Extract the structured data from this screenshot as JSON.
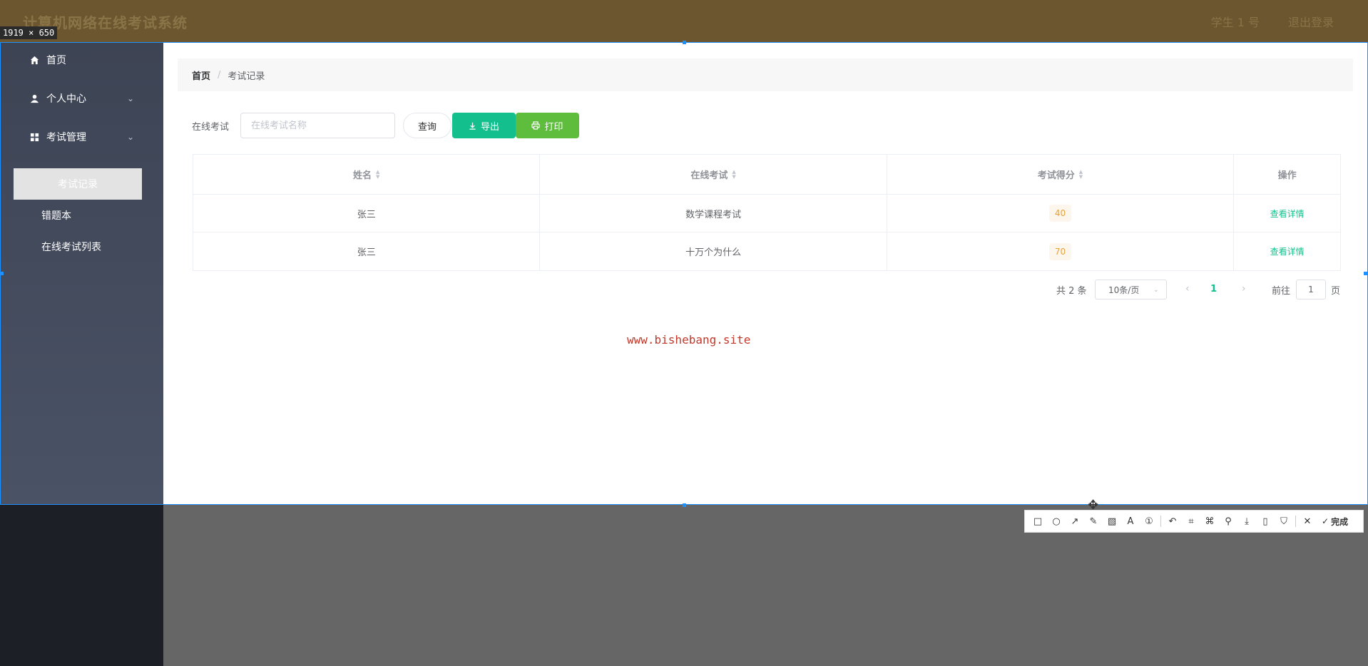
{
  "header": {
    "app_title": "计算机网络在线考试系统",
    "right_items": [
      "学生 1 号",
      "退出登录"
    ]
  },
  "size_tag": "1919 × 650",
  "sidebar": {
    "items": [
      {
        "label": "首页",
        "icon": "home-icon"
      },
      {
        "label": "个人中心",
        "icon": "user-icon"
      },
      {
        "label": "考试管理",
        "icon": "grid-icon"
      }
    ],
    "sub_items": [
      "考试记录",
      "错题本",
      "在线考试列表"
    ]
  },
  "breadcrumb": {
    "home": "首页",
    "separator": "/",
    "current": "考试记录"
  },
  "search": {
    "label": "在线考试",
    "placeholder": "在线考试名称",
    "query_label": "查询",
    "export_label": "导出",
    "print_label": "打印"
  },
  "table": {
    "headers": [
      "姓名",
      "在线考试",
      "考试得分",
      "操作"
    ],
    "rows": [
      {
        "name": "张三",
        "exam": "数学课程考试",
        "score": "40",
        "action": "查看详情"
      },
      {
        "name": "张三",
        "exam": "十万个为什么",
        "score": "70",
        "action": "查看详情"
      }
    ]
  },
  "pagination": {
    "total": "共 2 条",
    "page_size": "10条/页",
    "current_page": "1",
    "goto_label": "前往",
    "goto_value": "1",
    "page_suffix": "页"
  },
  "watermark": "www.bishebang.site",
  "capture_toolbar": {
    "done_label": "完成"
  },
  "colors": {
    "accent": "#13c08d",
    "print": "#5fbd3e",
    "sidebar": "#3d4454",
    "score_badge": "#e6a23c"
  }
}
